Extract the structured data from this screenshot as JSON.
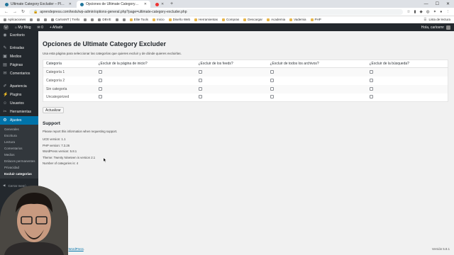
{
  "browser": {
    "tabs": [
      {
        "title": "Ultimate Category Excluder – Pl…",
        "active": false
      },
      {
        "title": "Opciones de Ultimate Category…",
        "active": true
      },
      {
        "title": "",
        "active": false
      }
    ],
    "new_tab_glyph": "+",
    "url": "aprendepress.com/tests/wp-admin/options-general.php?page=ultimate-category-excluder.php",
    "bookmarks": [
      {
        "label": "Aplicaciones",
        "kind": "apps"
      },
      {
        "label": "",
        "kind": "site"
      },
      {
        "label": "",
        "kind": "site"
      },
      {
        "label": "",
        "kind": "site"
      },
      {
        "label": "CarlosMT | Trello",
        "kind": "site"
      },
      {
        "label": "",
        "kind": "site"
      },
      {
        "label": "",
        "kind": "site"
      },
      {
        "label": "DBVE",
        "kind": "site"
      },
      {
        "label": "",
        "kind": "site"
      },
      {
        "label": "",
        "kind": "site"
      },
      {
        "label": "Elite Tools",
        "kind": "folder"
      },
      {
        "label": "Inicio",
        "kind": "folder"
      },
      {
        "label": "Diseño Web",
        "kind": "folder"
      },
      {
        "label": "Herramientas",
        "kind": "folder"
      },
      {
        "label": "Compras",
        "kind": "folder"
      },
      {
        "label": "Descargar",
        "kind": "folder"
      },
      {
        "label": "Academia",
        "kind": "folder"
      },
      {
        "label": "Vademia",
        "kind": "folder"
      },
      {
        "label": "PHP",
        "kind": "folder"
      }
    ],
    "bookmarks_right": "Lista de lectura"
  },
  "adminbar": {
    "site": "My Blog",
    "comments_count": "0",
    "new_label": "+ Añadir",
    "greeting": "Hola, carlosmr"
  },
  "sidebar": {
    "items": [
      {
        "label": "Escritorio",
        "icon": "dashboard-icon",
        "glyph": "◉"
      },
      {
        "label": "Entradas",
        "icon": "pin-icon",
        "glyph": "✎"
      },
      {
        "label": "Medios",
        "icon": "media-icon",
        "glyph": "▣"
      },
      {
        "label": "Páginas",
        "icon": "page-icon",
        "glyph": "▤"
      },
      {
        "label": "Comentarios",
        "icon": "comment-icon",
        "glyph": "✉"
      },
      {
        "label": "Apariencia",
        "icon": "brush-icon",
        "glyph": "✐"
      },
      {
        "label": "Plugins",
        "icon": "plugin-icon",
        "glyph": "⚡"
      },
      {
        "label": "Usuarios",
        "icon": "users-icon",
        "glyph": "☺"
      },
      {
        "label": "Herramientas",
        "icon": "tools-icon",
        "glyph": "✂"
      },
      {
        "label": "Ajustes",
        "icon": "settings-icon",
        "glyph": "⚙"
      }
    ],
    "submenu": [
      "Generales",
      "Escritura",
      "Lectura",
      "Comentarios",
      "Medios",
      "Enlaces permanentes",
      "Privacidad",
      "Excluir categorías"
    ],
    "collapse_label": "Cerrar menú"
  },
  "main": {
    "title": "Opciones de Ultimate Category Excluder",
    "description": "Usa esta página para seleccionar las categorías que quieres excluir y de dónde quieres excluirlas.",
    "table": {
      "headers": [
        "Categoría",
        "¿Excluir de la página de inicio?",
        "¿Excluir de los feeds?",
        "¿Excluir de todos los archivos?",
        "¿Excluir de la búsqueda?"
      ],
      "rows": [
        "Categoría 1",
        "Categoría 2",
        "Sin categoría",
        "Uncategorized"
      ]
    },
    "update_button": "Actualizar",
    "support": {
      "heading": "Support",
      "text": "Please report this information when requesting support.",
      "lines": [
        "UCE version: 1.1",
        "PHP version: 7.3.26",
        "WordPress version: 5.8.1",
        "Theme: Twenty Nineteen is version 2.1",
        "Number of categories is: 4"
      ]
    }
  },
  "footer": {
    "thanks_prefix": "…as por crear con ",
    "wordpress_link": "WordPress",
    "thanks_suffix": ".",
    "version": "Versión 5.8.1"
  },
  "colors": {
    "admin_dark": "#23282d",
    "accent": "#0073aa"
  }
}
